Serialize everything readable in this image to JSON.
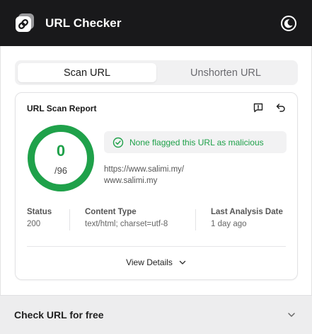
{
  "header": {
    "title": "URL Checker",
    "logo_icon": "link-icon",
    "theme_icon": "moon-icon"
  },
  "tabs": [
    {
      "label": "Scan URL",
      "active": true
    },
    {
      "label": "Unshorten URL",
      "active": false
    }
  ],
  "report": {
    "title": "URL Scan Report",
    "actions": [
      "feedback-icon",
      "undo-icon"
    ],
    "score": {
      "flagged": "0",
      "total": "/96",
      "flagged_value": 0,
      "total_value": 96
    },
    "status_message": "None flagged this URL as malicious",
    "url_line1": "https://www.salimi.my/",
    "url_line2": "www.salimi.my",
    "meta": [
      {
        "label": "Status",
        "value": "200"
      },
      {
        "label": "Content Type",
        "value": "text/html; charset=utf-8"
      },
      {
        "label": "Last Analysis Date",
        "value": "1 day ago"
      }
    ],
    "view_details_label": "View Details"
  },
  "footer": {
    "label": "Check URL for free"
  },
  "colors": {
    "header_bg": "#19191b",
    "success": "#1fa14a",
    "tab_bg": "#f1f1f2",
    "footer_bg": "#ededee"
  }
}
